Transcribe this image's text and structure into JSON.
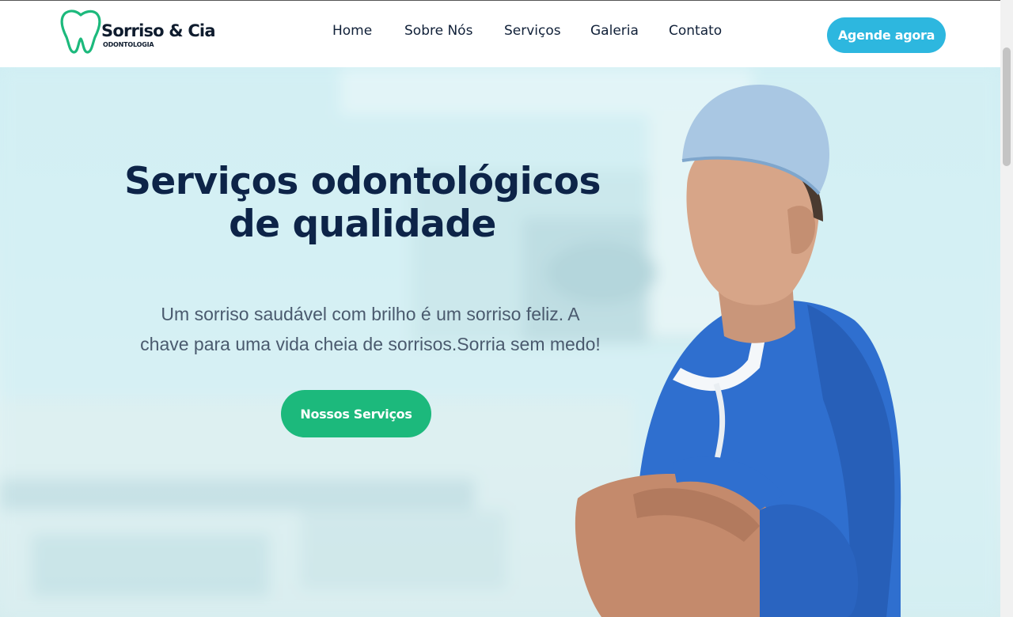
{
  "brand": {
    "name": "Sorriso & Cia",
    "subtitle": "ODONTOLOGIA"
  },
  "nav": {
    "items": [
      {
        "label": "Home"
      },
      {
        "label": "Sobre Nós"
      },
      {
        "label": "Serviços"
      },
      {
        "label": "Galeria"
      },
      {
        "label": "Contato"
      }
    ],
    "cta_label": "Agende agora"
  },
  "hero": {
    "title_line1": "Serviços odontológicos",
    "title_line2": "de qualidade",
    "text_line1": "Um sorriso saudável com brilho é um sorriso feliz. A",
    "text_line2": "chave para uma vida cheia de sorrisos.Sorria sem medo!",
    "button_label": "Nossos Serviços"
  },
  "colors": {
    "brand_green": "#1cb97c",
    "accent_blue": "#2db7df",
    "heading_navy": "#0d2448"
  }
}
